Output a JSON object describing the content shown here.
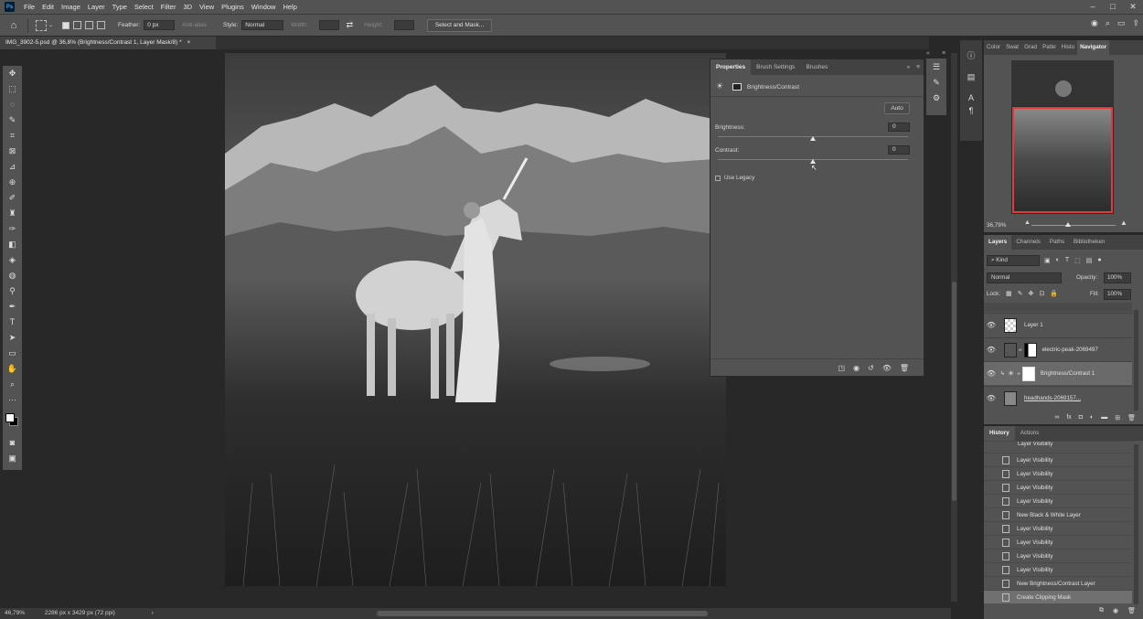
{
  "menu": {
    "app_logo": "Ps",
    "items": [
      "File",
      "Edit",
      "Image",
      "Layer",
      "Type",
      "Select",
      "Filter",
      "3D",
      "View",
      "Plugins",
      "Window",
      "Help"
    ]
  },
  "options_bar": {
    "feather_label": "Feather:",
    "feather_value": "0 px",
    "antialias_label": "Anti-alias",
    "style_label": "Style:",
    "style_value": "Normal",
    "width_label": "Width:",
    "height_label": "Height:",
    "select_mask_button": "Select and Mask..."
  },
  "document": {
    "tab_title": "IMG_3902-5.psd @ 36,8% (Brightness/Contrast 1, Layer Mask/8) *",
    "tab_close": "×"
  },
  "status_bar": {
    "zoom": "46,79%",
    "doc_info": "2286 px x 3429 px (72 ppi)",
    "arrow": "›"
  },
  "properties_panel": {
    "tabs": [
      "Properties",
      "Brush Settings",
      "Brushes"
    ],
    "adjustment_title": "Brightness/Contrast",
    "auto_button": "Auto",
    "brightness_label": "Brightness:",
    "brightness_value": "0",
    "contrast_label": "Contrast:",
    "contrast_value": "0",
    "legacy_label": "Use Legacy",
    "brightness_level": 0,
    "contrast_level": 0
  },
  "navigator_panel": {
    "tabs": [
      "Color",
      "Swat",
      "Grad",
      "Patte",
      "Histo",
      "Navigator"
    ],
    "zoom": "36,79%"
  },
  "layers_panel": {
    "tabs": [
      "Layers",
      "Channels",
      "Paths",
      "Bibliotheken"
    ],
    "filter_kind": "Kind",
    "blend_mode": "Normal",
    "opacity_label": "Opacity:",
    "opacity_value": "100%",
    "lock_label": "Lock:",
    "fill_label": "Fill:",
    "fill_value": "100%",
    "layers": [
      {
        "name": "Layer 1"
      },
      {
        "name": "electric-peak-2069497"
      },
      {
        "name": "Brightness/Contrast 1",
        "selected": true
      },
      {
        "name": "headhands-2069157..."
      }
    ]
  },
  "history_panel": {
    "tabs": [
      "History",
      "Actions"
    ],
    "items": [
      "Layer Visibility",
      "Layer Visibility",
      "Layer Visibility",
      "Layer Visibility",
      "Layer Visibility",
      "New Black & White Layer",
      "Layer Visibility",
      "Layer Visibility",
      "Layer Visibility",
      "Layer Visibility",
      "New Brightness/Contrast Layer",
      "Create Clipping Mask"
    ],
    "top_partial": "Layer Visibility"
  }
}
